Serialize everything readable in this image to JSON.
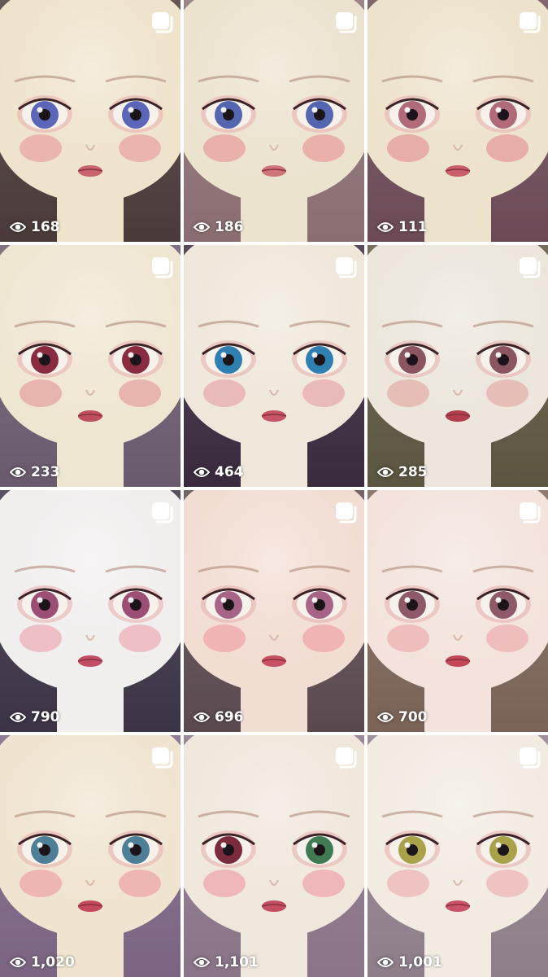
{
  "tiles": [
    {
      "views": "168",
      "bg": "#4a3a3a",
      "skin": "#efe3cc",
      "iris": "#5b66b8",
      "lip": "#c9636e",
      "blush": "#e7a6a2"
    },
    {
      "views": "186",
      "bg": "#8a6e72",
      "skin": "#ece3cf",
      "iris": "#5566b0",
      "lip": "#cf7479",
      "blush": "#e8a09c"
    },
    {
      "views": "111",
      "bg": "#6b4a56",
      "skin": "#ede2cb",
      "iris": "#b06a78",
      "lip": "#c85f6a",
      "blush": "#e39c98"
    },
    {
      "views": "233",
      "bg": "#6a5a6e",
      "skin": "#efe6d2",
      "iris": "#8a2c40",
      "lip": "#bf4f5e",
      "blush": "#e6a3a1"
    },
    {
      "views": "464",
      "bg": "#3a2a3e",
      "skin": "#efe7da",
      "iris": "#2f7fb0",
      "lip": "#c65567",
      "blush": "#e8a9ae"
    },
    {
      "views": "285",
      "bg": "#5c5540",
      "skin": "#ece6dc",
      "iris": "#8b5560",
      "lip": "#b23f4c",
      "blush": "#e3b0aa"
    },
    {
      "views": "790",
      "bg": "#3c3346",
      "skin": "#f1eeee",
      "iris": "#9c4e74",
      "lip": "#c14e64",
      "blush": "#ecb0b7"
    },
    {
      "views": "696",
      "bg": "#5a4a50",
      "skin": "#f2ddd3",
      "iris": "#a86487",
      "lip": "#c85063",
      "blush": "#efa5ab"
    },
    {
      "views": "700",
      "bg": "#7a6356",
      "skin": "#f3e3dc",
      "iris": "#8e5a6a",
      "lip": "#c24857",
      "blush": "#eeb0b2"
    },
    {
      "views": "1,020",
      "bg": "#7a6482",
      "skin": "#f0e4d0",
      "iris": "#4f7f96",
      "lip": "#c34a5c",
      "blush": "#eda6a8"
    },
    {
      "views": "1,101",
      "bg": "#8a7488",
      "skin": "#f0e7dc",
      "iris": "#7a2c3c",
      "iris2": "#3f7a52",
      "lip": "#c44f63",
      "blush": "#efa7ad"
    },
    {
      "views": "1,001",
      "bg": "#8e7e8a",
      "skin": "#f2ebe2",
      "iris": "#a9a24a",
      "lip": "#c7526a",
      "blush": "#eeb5b5"
    }
  ]
}
